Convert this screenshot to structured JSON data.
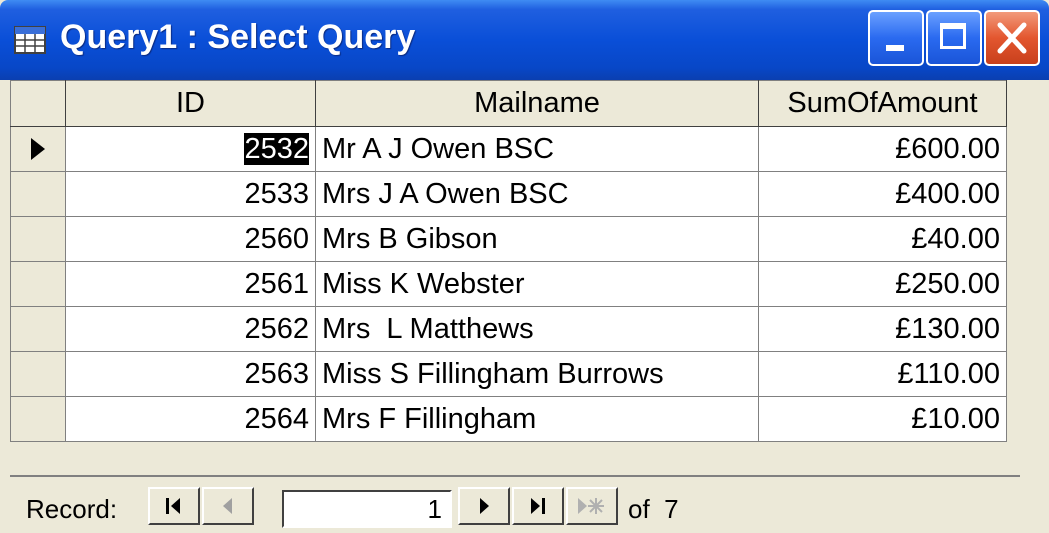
{
  "window": {
    "title": "Query1 : Select Query",
    "icon": "datasheet-icon",
    "controls": [
      "minimize-icon",
      "maximize-icon",
      "close-icon"
    ]
  },
  "table": {
    "headers": [
      "ID",
      "Mailname",
      "SumOfAmount"
    ],
    "rows": [
      {
        "id": "2532",
        "mailname": "Mr A J Owen BSC",
        "sum": "£600.00",
        "current": true
      },
      {
        "id": "2533",
        "mailname": "Mrs J A Owen BSC",
        "sum": "£400.00"
      },
      {
        "id": "2560",
        "mailname": "Mrs B Gibson",
        "sum": "£40.00"
      },
      {
        "id": "2561",
        "mailname": "Miss K Webster",
        "sum": "£250.00"
      },
      {
        "id": "2562",
        "mailname": "Mrs  L Matthews",
        "sum": "£130.00"
      },
      {
        "id": "2563",
        "mailname": "Miss S Fillingham Burrows",
        "sum": "£110.00"
      },
      {
        "id": "2564",
        "mailname": "Mrs F Fillingham",
        "sum": "£10.00"
      }
    ]
  },
  "navigation": {
    "label": "Record:",
    "current": "1",
    "total_text": "of  7",
    "buttons": [
      "first-record-icon",
      "previous-record-icon",
      "next-record-icon",
      "last-record-icon",
      "new-record-icon"
    ]
  },
  "colors": {
    "titlebar": "#0a4fd8",
    "window_bg": "#ece9d8",
    "close_button": "#e3562f"
  }
}
